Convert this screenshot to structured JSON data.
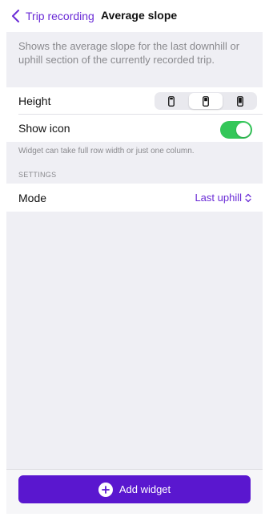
{
  "header": {
    "back_label": "Trip recording",
    "title": "Average slope"
  },
  "description": "Shows the average slope for the last downhill or uphill section of the currently recorded trip.",
  "height_row": {
    "label": "Height",
    "options": [
      "small-phone-icon",
      "medium-phone-icon",
      "large-phone-icon"
    ],
    "selected_index": 1
  },
  "show_icon_row": {
    "label": "Show icon",
    "value": true
  },
  "note": "Widget can take full row width or just one column.",
  "settings": {
    "section_title": "SETTINGS",
    "mode_label": "Mode",
    "mode_value": "Last uphill"
  },
  "footer": {
    "add_label": "Add widget"
  },
  "colors": {
    "accent": "#6a2bd6",
    "button": "#5a17cf",
    "toggle_on": "#34c759",
    "background": "#efeff4"
  }
}
